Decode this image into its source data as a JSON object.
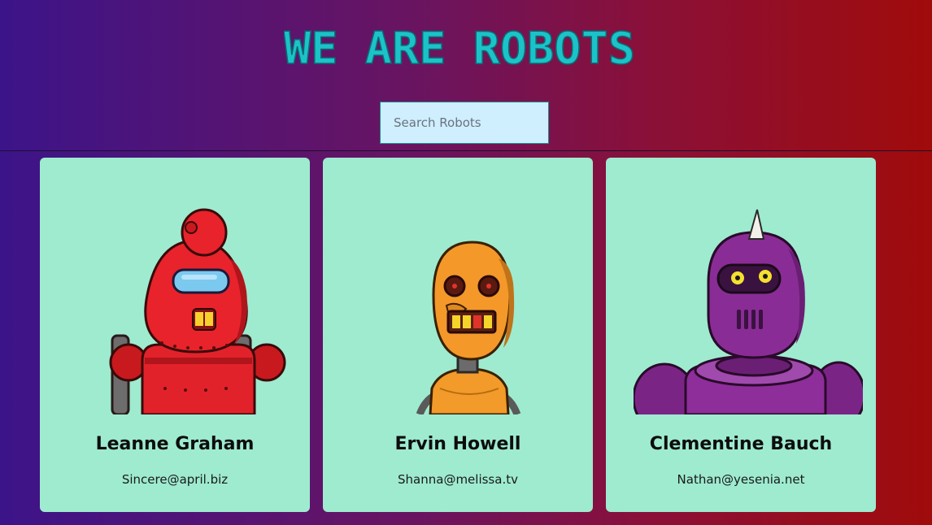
{
  "app": {
    "title": "WE ARE ROBOTS"
  },
  "search": {
    "placeholder": "Search Robots",
    "value": ""
  },
  "colors": {
    "title": "#1bc3c8",
    "card_background": "#9eebd0",
    "search_background": "#cfeefe"
  },
  "robots": [
    {
      "name": "Leanne Graham",
      "email": "Sincere@april.biz",
      "icon": "red-robot-icon"
    },
    {
      "name": "Ervin Howell",
      "email": "Shanna@melissa.tv",
      "icon": "orange-robot-icon"
    },
    {
      "name": "Clementine Bauch",
      "email": "Nathan@yesenia.net",
      "icon": "purple-robot-icon"
    }
  ]
}
